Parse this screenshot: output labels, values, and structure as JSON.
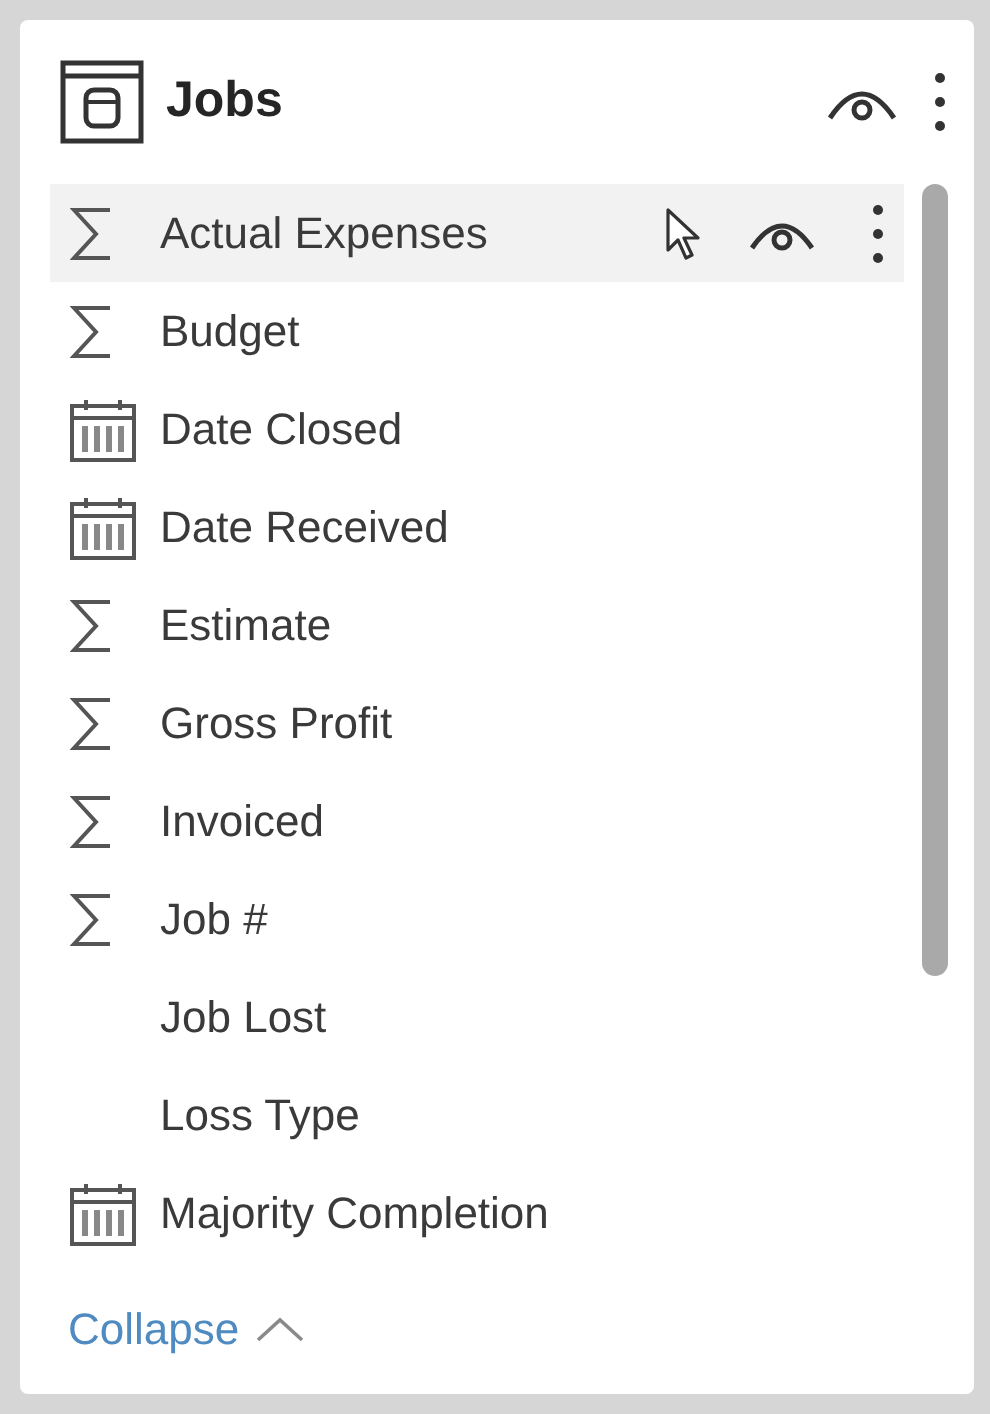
{
  "table": {
    "title": "Jobs"
  },
  "fields": [
    {
      "kind": "sum",
      "label": "Actual Expenses",
      "hovered": true
    },
    {
      "kind": "sum",
      "label": "Budget",
      "hovered": false
    },
    {
      "kind": "date",
      "label": "Date Closed",
      "hovered": false
    },
    {
      "kind": "date",
      "label": "Date Received",
      "hovered": false
    },
    {
      "kind": "sum",
      "label": "Estimate",
      "hovered": false
    },
    {
      "kind": "sum",
      "label": "Gross Profit",
      "hovered": false
    },
    {
      "kind": "sum",
      "label": "Invoiced",
      "hovered": false
    },
    {
      "kind": "sum",
      "label": "Job #",
      "hovered": false
    },
    {
      "kind": "text",
      "label": "Job Lost",
      "hovered": false
    },
    {
      "kind": "text",
      "label": "Loss Type",
      "hovered": false
    },
    {
      "kind": "date",
      "label": "Majority Completion",
      "hovered": false
    }
  ],
  "collapse": {
    "label": "Collapse"
  }
}
